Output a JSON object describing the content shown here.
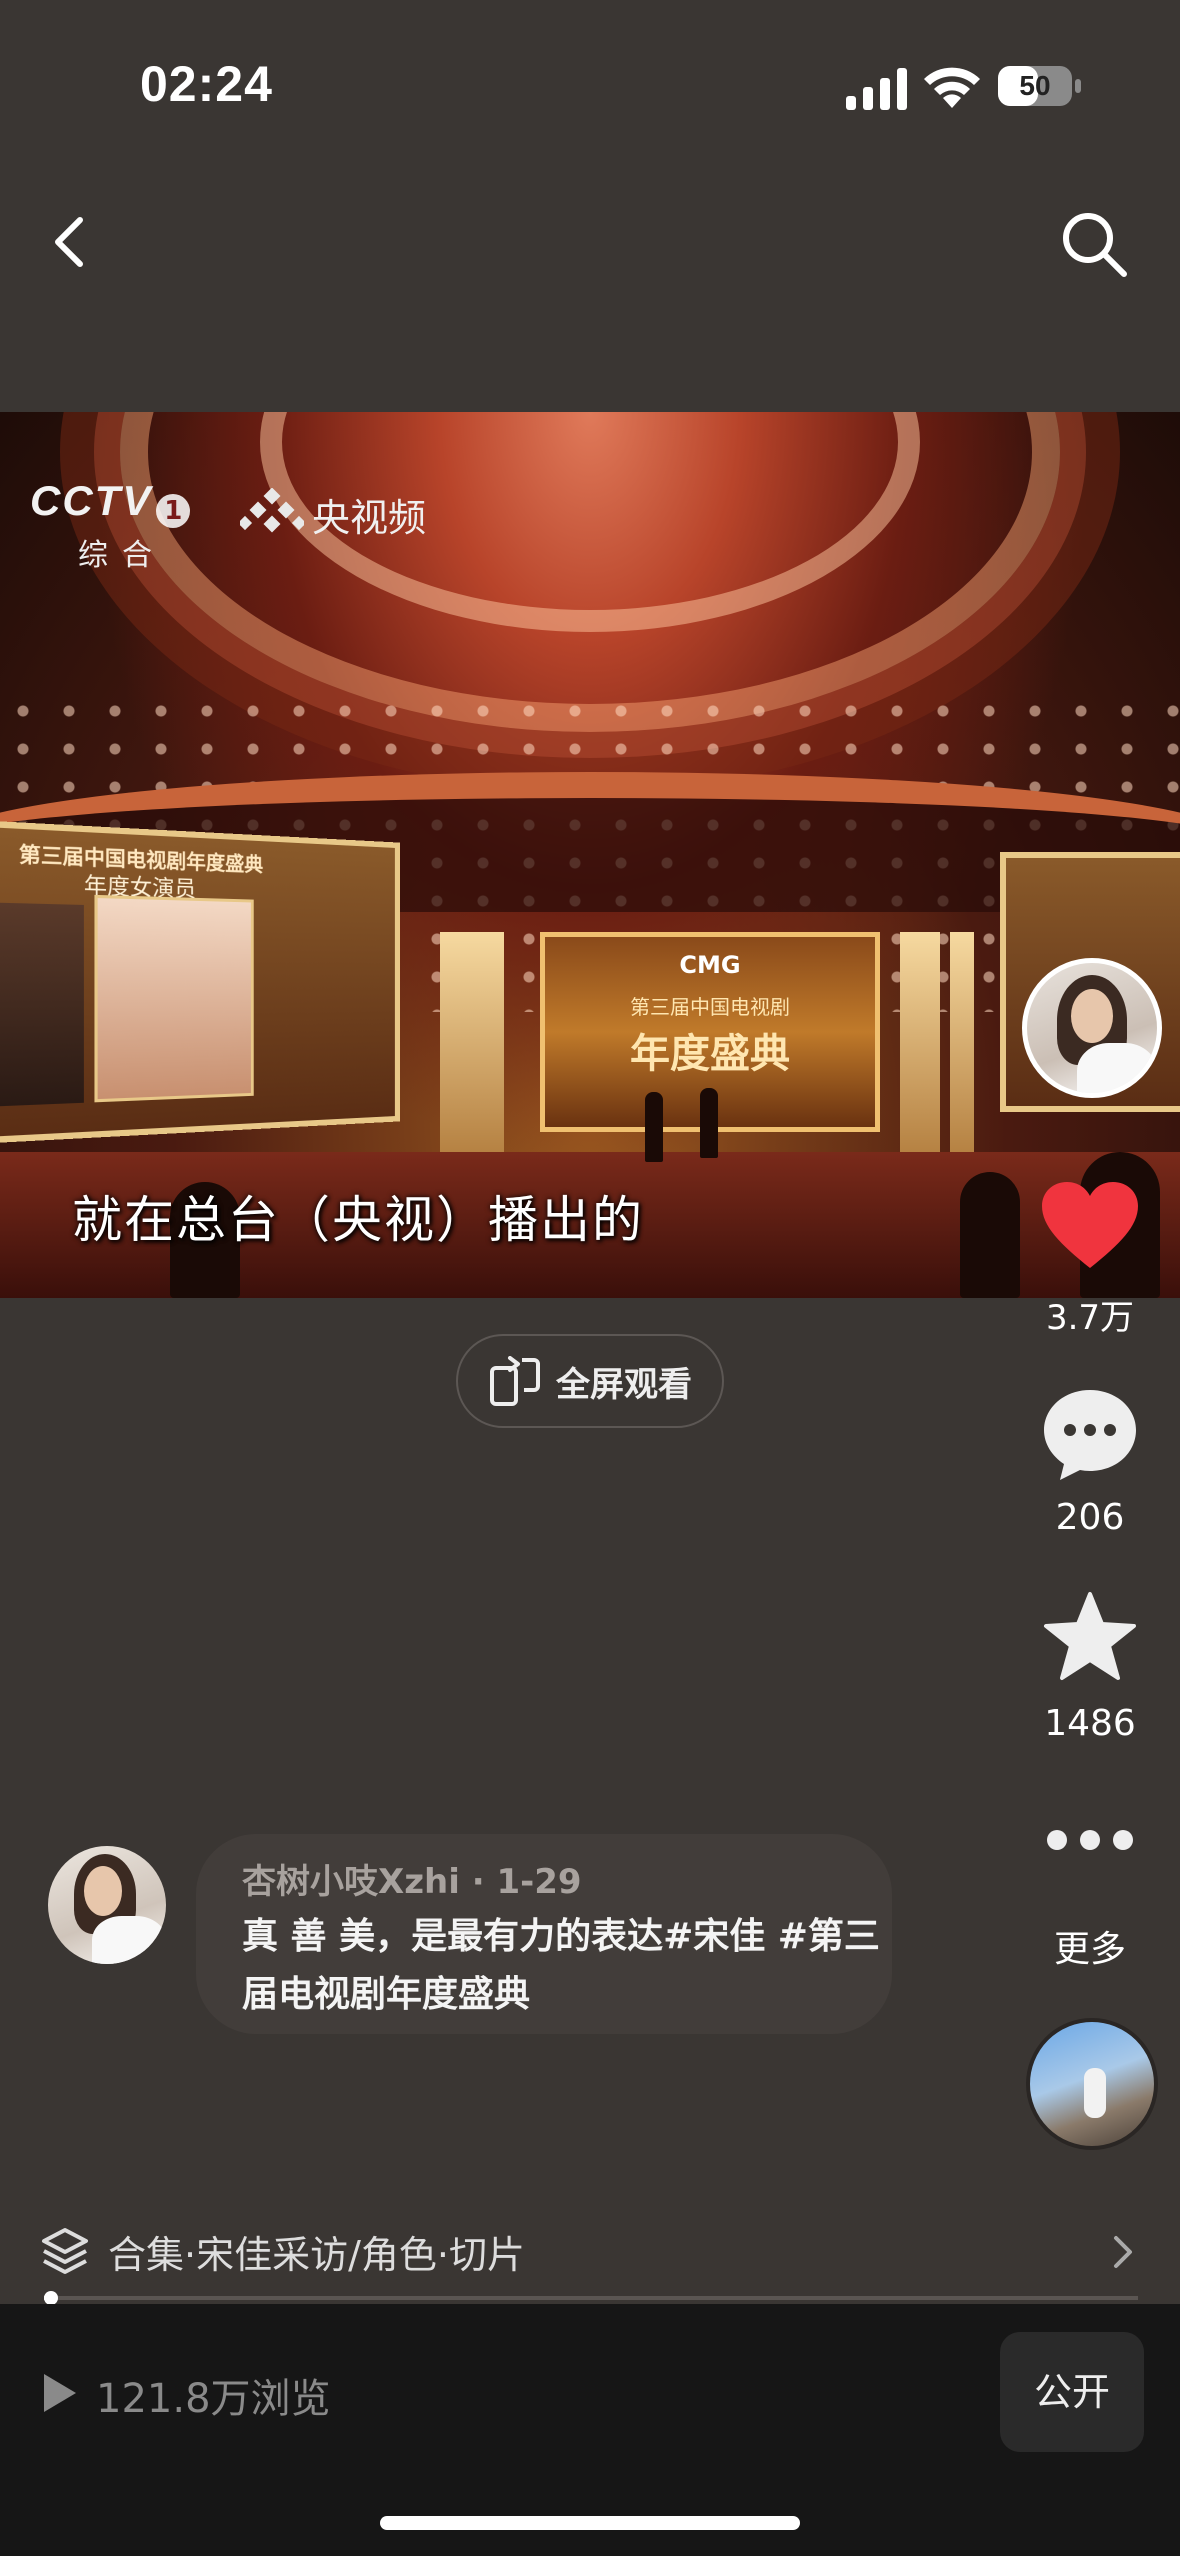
{
  "status_bar": {
    "time": "02:24",
    "battery": "50"
  },
  "video": {
    "channel_logo": "CCTV",
    "channel_number": "1",
    "channel_sub": "综合",
    "platform_logo": "央视频",
    "stage_brand": "CMG",
    "stage_line1": "第三届中国电视剧",
    "stage_line2": "年度盛典",
    "screen_title": "第三届中国电视剧年度盛典",
    "screen_subtitle": "年度女演员",
    "subtitle": "就在总台（央视）播出的"
  },
  "fullscreen_button": {
    "label": "全屏观看"
  },
  "side_actions": {
    "likes": "3.7万",
    "comments": "206",
    "favorites": "1486",
    "more_label": "更多"
  },
  "post": {
    "author": "杏树小吱Xzhi",
    "date": "1-29",
    "separator": "·",
    "text": "真 善 美，是最有力的表达#宋佳 #第三届电视剧年度盛典"
  },
  "collection": {
    "label": "合集·宋佳采访/角色·切片"
  },
  "progress": {
    "fraction": 0.002
  },
  "bottom_bar": {
    "views": "121.8万浏览",
    "visibility_button": "公开"
  },
  "colors": {
    "like": "#f0343e",
    "background": "#3a3633",
    "bottom_bar": "#161616"
  }
}
